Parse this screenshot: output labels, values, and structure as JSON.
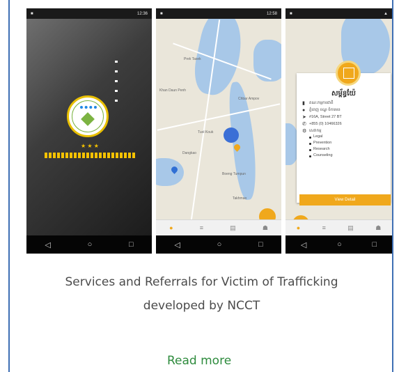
{
  "phones": {
    "splash": {
      "time": "12:36"
    },
    "map": {
      "time": "12:58",
      "labels": [
        "Prek Tasek",
        "Khan Daun Penh",
        "Chbar Ampov",
        "Tuol Kouk",
        "Dangkao",
        "Boeng Tumpun",
        "Takhmao"
      ]
    },
    "detail": {
      "title": "សម្ព័ន្ធយ៉ែ",
      "org": "គណៈកម្មការជាតិ",
      "address_kh": "ភ្នំពេញ ខណ្ឌ ចំការមន",
      "street": "#16A, Street 27 BT",
      "phone": "+855 (0) 10466326",
      "services_heading": "សេវាកម្ម",
      "services": [
        "Legal",
        "Prevention",
        "Research",
        "Counseling"
      ],
      "button": "View Detail"
    }
  },
  "icons": {
    "back": "◁",
    "home": "○",
    "recent": "□",
    "location": "location-icon",
    "list": "list-icon",
    "wallet": "wallet-icon",
    "people": "people-icon"
  },
  "description_line1": "Services and Referrals for Victim of Trafficking",
  "description_line2": "developed by NCCT",
  "read_more": "Read more",
  "colors": {
    "accent": "#f0a81c",
    "link": "#2e8b3d",
    "frame": "#3e6fb4"
  }
}
